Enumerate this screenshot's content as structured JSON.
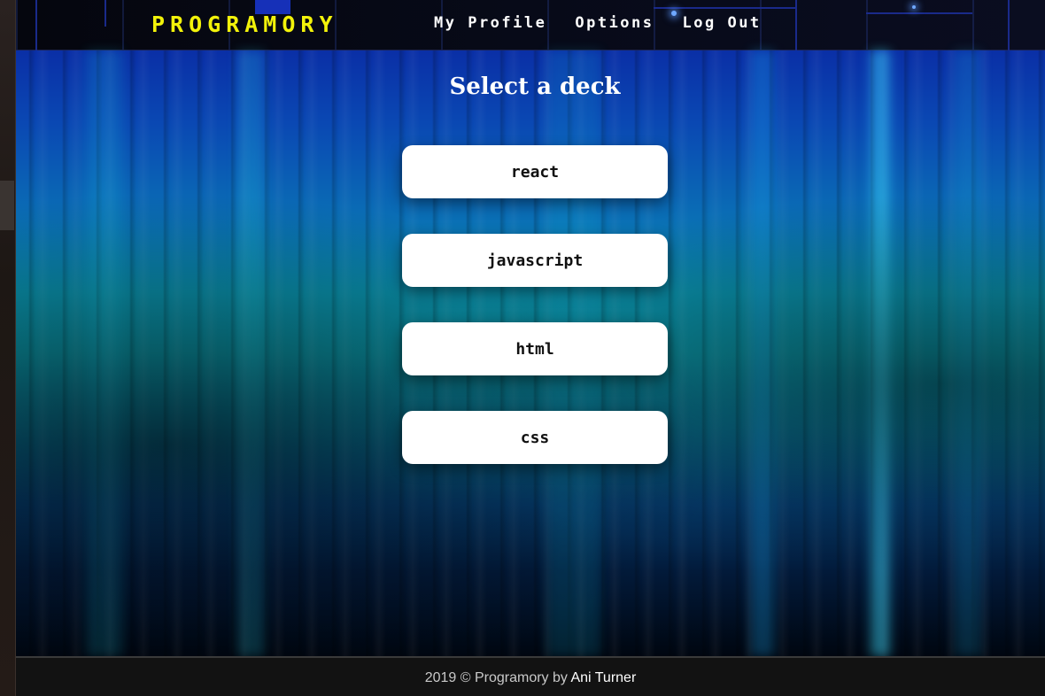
{
  "navbar": {
    "brand": "PROGRAMORY",
    "links": [
      "My Profile",
      "Options",
      "Log Out"
    ]
  },
  "main": {
    "title": "Select a deck",
    "decks": [
      "react",
      "javascript",
      "html",
      "css"
    ]
  },
  "footer": {
    "text": "2019 © Programory by",
    "author": "Ani Turner"
  },
  "colors": {
    "brand": "#f2f20a",
    "nav_text": "#ffffff",
    "deck_button_bg": "#ffffff",
    "footer_bg": "#121212"
  }
}
